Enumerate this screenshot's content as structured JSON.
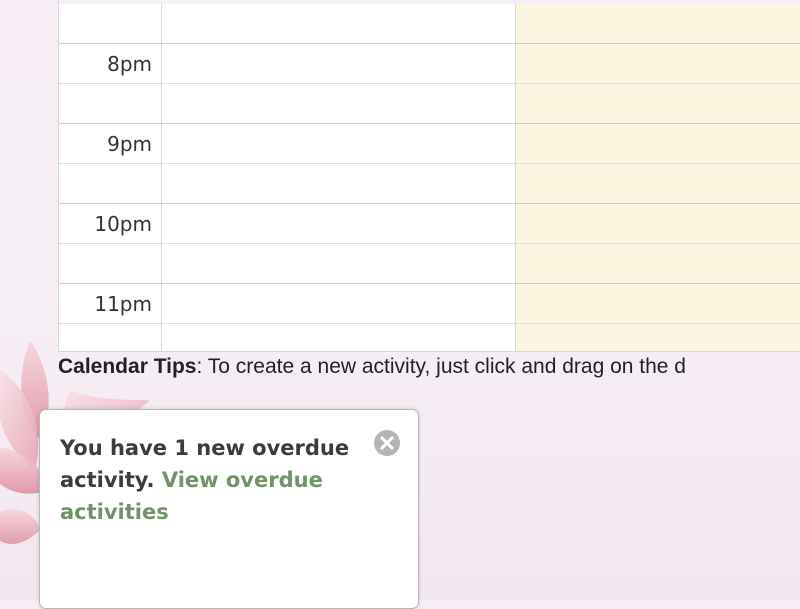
{
  "calendar": {
    "rows": [
      {
        "time": ""
      },
      {
        "time": "8pm"
      },
      {
        "time": ""
      },
      {
        "time": "9pm"
      },
      {
        "time": ""
      },
      {
        "time": "10pm"
      },
      {
        "time": ""
      },
      {
        "time": "11pm"
      }
    ]
  },
  "tips": {
    "label": "Calendar Tips",
    "text": ": To create a new activity, just click and drag on the d"
  },
  "notification": {
    "message": "You have 1 new overdue activity.",
    "link_text": "View overdue activities",
    "close_icon": "close-icon"
  },
  "colors": {
    "weekend_column": "#fcf6e1",
    "link": "#6e9468"
  }
}
